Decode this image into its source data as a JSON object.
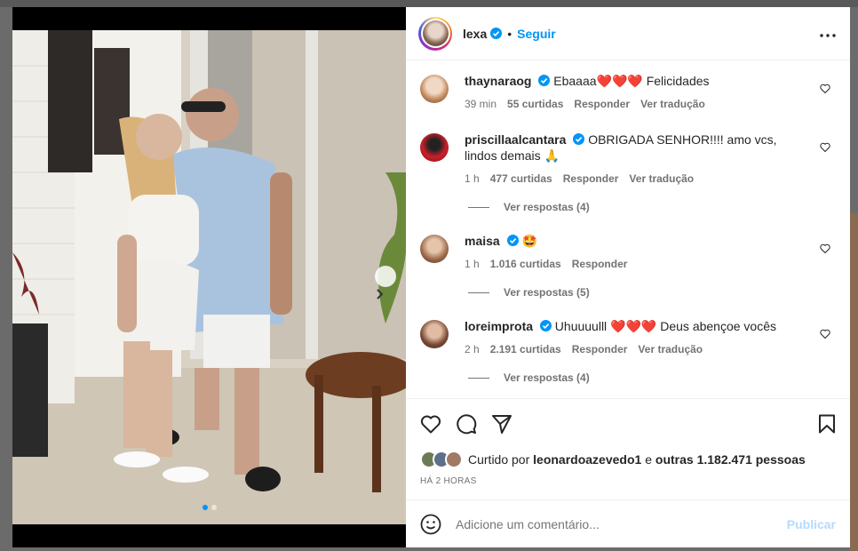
{
  "post": {
    "username": "lexa",
    "follow_label": "Seguir",
    "separator": "•"
  },
  "comments": [
    {
      "username": "thaynaraog",
      "text": "Ebaaaa❤️❤️❤️ Felicidades",
      "time": "39 min",
      "likes": "55 curtidas",
      "reply_label": "Responder",
      "translate_label": "Ver tradução",
      "view_replies": ""
    },
    {
      "username": "priscillaalcantara",
      "text": "OBRIGADA SENHOR!!!! amo vcs, lindos demais 🙏",
      "time": "1 h",
      "likes": "477 curtidas",
      "reply_label": "Responder",
      "translate_label": "Ver tradução",
      "view_replies": "Ver respostas (4)"
    },
    {
      "username": "maisa",
      "text": "🤩",
      "time": "1 h",
      "likes": "1.016 curtidas",
      "reply_label": "Responder",
      "translate_label": "",
      "view_replies": "Ver respostas (5)"
    },
    {
      "username": "loreimprota",
      "text": "Uhuuuulll ❤️❤️❤️ Deus abençoe vocês",
      "time": "2 h",
      "likes": "2.191 curtidas",
      "reply_label": "Responder",
      "translate_label": "Ver tradução",
      "view_replies": "Ver respostas (4)"
    }
  ],
  "likes": {
    "prefix": "Curtido por",
    "user": "leonardoazevedo1",
    "connector": "e",
    "others": "outras 1.182.471 pessoas"
  },
  "timestamp": "HÁ 2 HORAS",
  "composer": {
    "placeholder": "Adicione um comentário...",
    "publish_label": "Publicar"
  },
  "carousel": {
    "current_index": 1,
    "total": 2
  },
  "colors": {
    "accent": "#0095f6",
    "publish_disabled": "#b3dbff",
    "muted": "#737373"
  }
}
